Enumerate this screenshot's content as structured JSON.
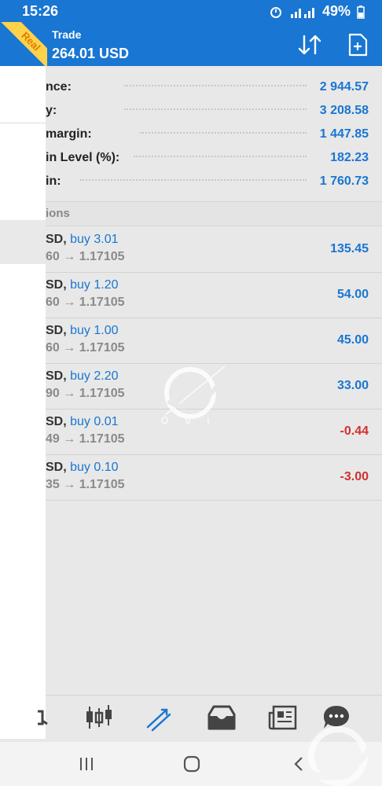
{
  "status_bar": {
    "time": "15:26",
    "battery": "49%"
  },
  "header": {
    "title": "Trade",
    "subtitle": "264.01 USD",
    "badge": "Real"
  },
  "account": [
    {
      "label": "nce:",
      "value": "2 944.57"
    },
    {
      "label": "y:",
      "value": "3 208.58"
    },
    {
      "label": "margin:",
      "value": "1 447.85"
    },
    {
      "label": "in Level (%):",
      "value": "182.23"
    },
    {
      "label": "in:",
      "value": "1 760.73"
    }
  ],
  "section_title": "ions",
  "positions": [
    {
      "symbol": "SD,",
      "side": "buy 3.01",
      "prices": "60 → 1.17105",
      "profit": "135.45",
      "sign": "positive"
    },
    {
      "symbol": "SD,",
      "side": "buy 1.20",
      "prices": "60 → 1.17105",
      "profit": "54.00",
      "sign": "positive"
    },
    {
      "symbol": "SD,",
      "side": "buy 1.00",
      "prices": "60 → 1.17105",
      "profit": "45.00",
      "sign": "positive"
    },
    {
      "symbol": "SD,",
      "side": "buy 2.20",
      "prices": "90 → 1.17105",
      "profit": "33.00",
      "sign": "positive"
    },
    {
      "symbol": "SD,",
      "side": "buy 0.01",
      "prices": "49 → 1.17105",
      "profit": "-0.44",
      "sign": "negative"
    },
    {
      "symbol": "SD,",
      "side": "buy 0.10",
      "prices": "35 → 1.17105",
      "profit": "-3.00",
      "sign": "negative"
    }
  ],
  "watermark": "O u i",
  "colors": {
    "primary": "#1976d2",
    "negative": "#d32f2f",
    "badge": "#ffd24a"
  },
  "icons": {
    "header": [
      "sort-icon",
      "new-order-icon"
    ],
    "tabs": [
      "quotes-icon",
      "chart-icon",
      "trade-icon",
      "history-icon",
      "news-icon",
      "chat-icon"
    ],
    "nav": [
      "recent-apps-icon",
      "home-icon",
      "back-icon"
    ]
  }
}
